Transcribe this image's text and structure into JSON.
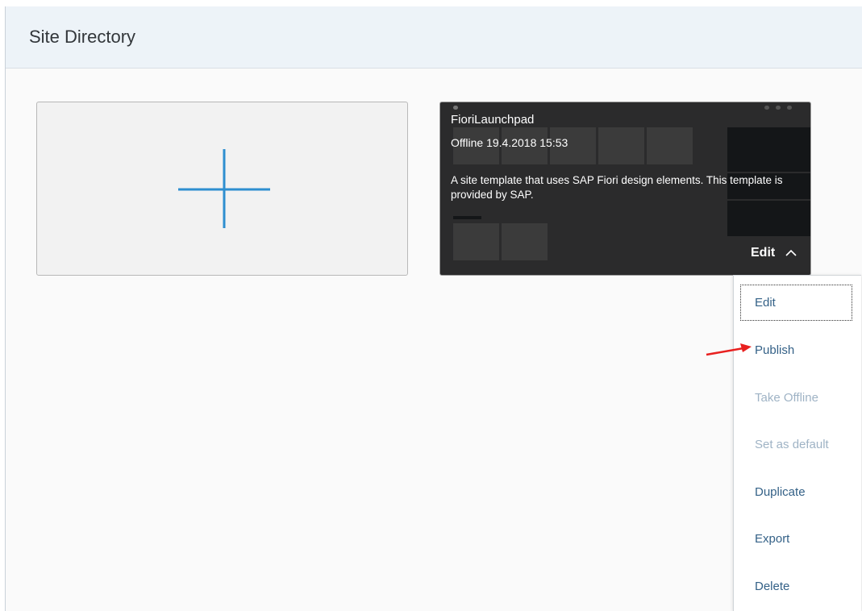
{
  "header": {
    "title": "Site Directory"
  },
  "add_tile": {
    "icon": "plus-icon",
    "color": "#2e8fd0"
  },
  "site": {
    "name": "FioriLaunchpad",
    "status": "Offline 19.4.2018 15:53",
    "description": "A site template that uses SAP Fiori design elements. This template is provided by SAP.",
    "edit_label": "Edit",
    "edit_icon": "chevron-up-icon"
  },
  "menu": {
    "items": [
      {
        "label": "Edit",
        "enabled": true
      },
      {
        "label": "Publish",
        "enabled": true
      },
      {
        "label": "Take Offline",
        "enabled": false
      },
      {
        "label": "Set as default",
        "enabled": false
      },
      {
        "label": "Duplicate",
        "enabled": true
      },
      {
        "label": "Export",
        "enabled": true
      },
      {
        "label": "Delete",
        "enabled": true
      }
    ]
  },
  "annotation": {
    "icon": "red-arrow-icon",
    "color": "#e8201f"
  }
}
